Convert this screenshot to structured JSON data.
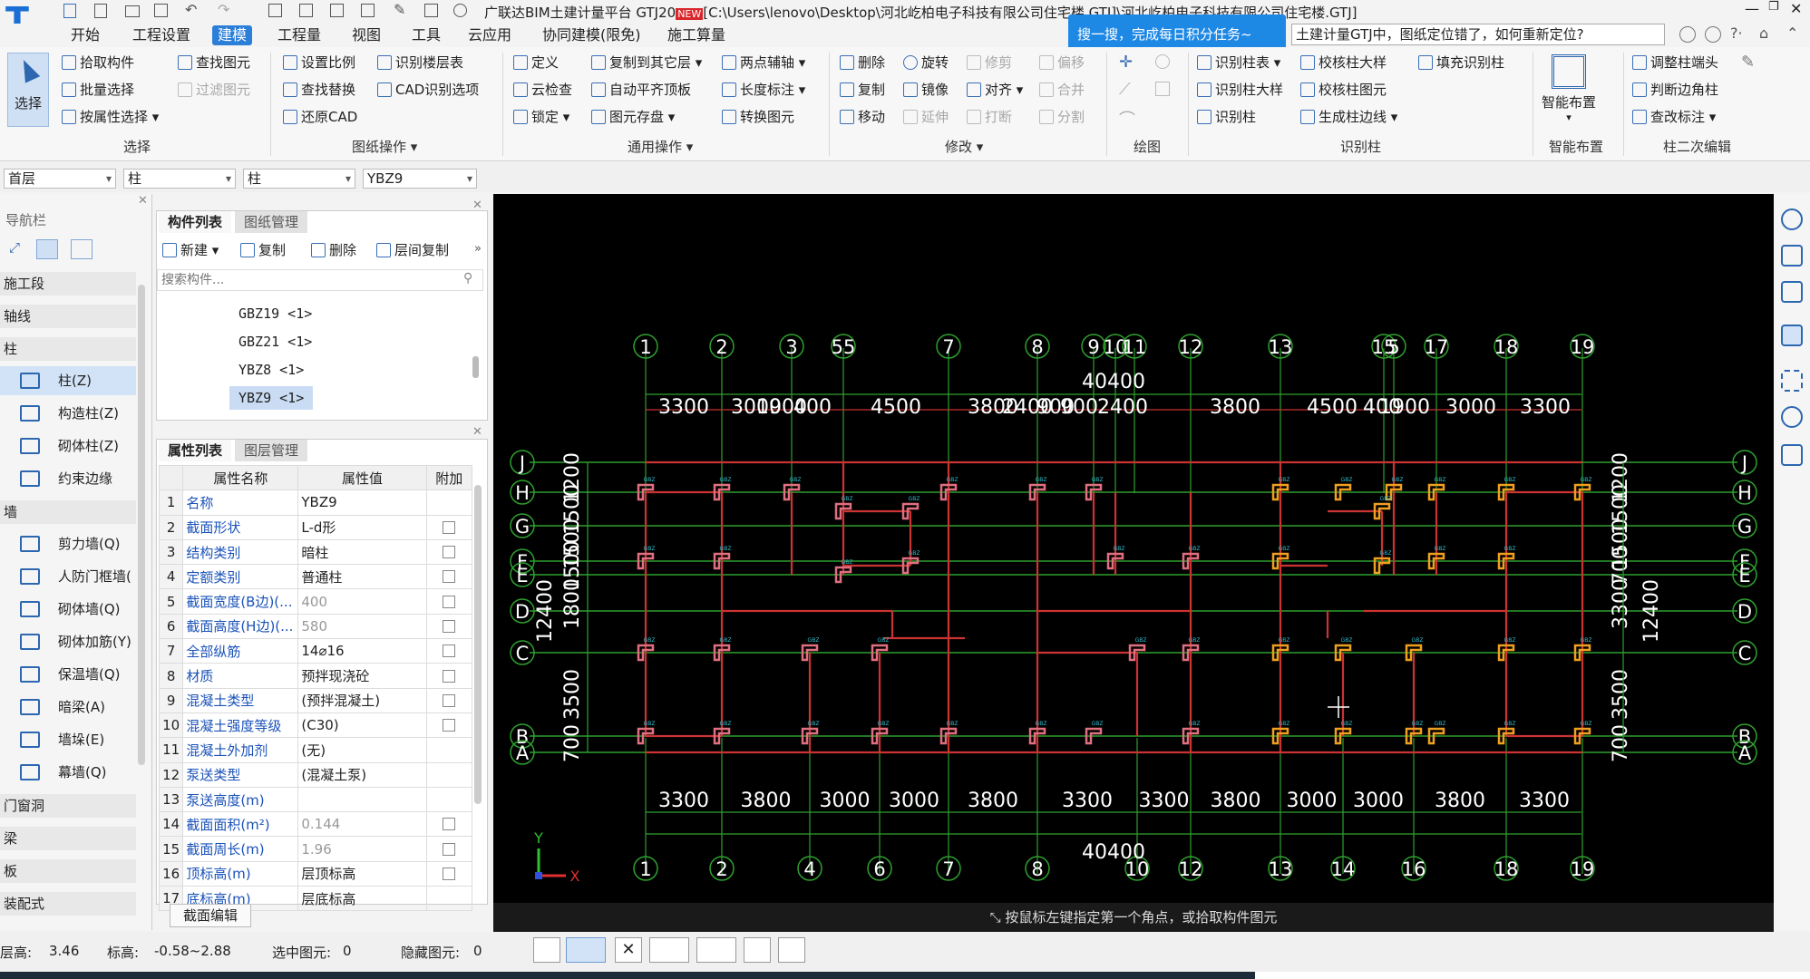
{
  "titlebar": {
    "title": "广联达BIM土建计量平台 GTJ20",
    "badge": "NEW",
    "path": "[C:\\Users\\lenovo\\Desktop\\河北屹柏电子科技有限公司住宅楼.GTJ]\\河北屹柏电子科技有限公司住宅楼.GTJ]",
    "popup": "搜一搜，完成每日积分任务~",
    "search_value": "土建计量GTJ中，图纸定位错了，如何重新定位?"
  },
  "menu": [
    "开始",
    "工程设置",
    "建模",
    "工程量",
    "视图",
    "工具",
    "云应用",
    "协同建模(限免)",
    "施工算量"
  ],
  "menu_active": "建模",
  "ribbon": {
    "select": "选择",
    "pick": "拾取构件",
    "batch": "批量选择",
    "byprop": "按属性选择",
    "findimg": "查找图元",
    "filterimg": "过滤图元",
    "grp_select": "选择",
    "setscale": "设置比例",
    "findreplace": "查找替换",
    "restorecad": "还原CAD",
    "idfloor": "识别楼层表",
    "cadopt": "CAD识别选项",
    "grp_drawing": "图纸操作",
    "define": "定义",
    "cloudcheck": "云检查",
    "lock": "锁定",
    "copyfloor": "复制到其它层",
    "autoalign": "自动平齐顶板",
    "saveimg": "图元存盘",
    "twopoint": "两点辅轴",
    "lengthmark": "长度标注",
    "convert": "转换图元",
    "grp_general": "通用操作",
    "delete": "删除",
    "copy": "复制",
    "move": "移动",
    "rotate": "旋转",
    "mirror": "镜像",
    "extend": "延伸",
    "trim": "修剪",
    "align": "对齐",
    "break": "打断",
    "offset": "偏移",
    "merge": "合并",
    "split": "分割",
    "grp_modify": "修改",
    "grp_draw": "绘图",
    "idcoltable": "识别柱表",
    "idcolbig": "识别柱大样",
    "idcol": "识别柱",
    "checkcolbig": "校核柱大样",
    "checkcol": "校核柱图元",
    "genedge": "生成柱边线",
    "fillcol": "填充识别柱",
    "grp_idcol": "识别柱",
    "smart": "智能布置",
    "grp_smart": "智能布置",
    "adjhead": "调整柱端头",
    "judgecorner": "判断边角柱",
    "changemark": "查改标注",
    "grp_second": "柱二次编辑"
  },
  "selectors": [
    "首层",
    "柱",
    "柱",
    "YBZ9"
  ],
  "nav": {
    "title": "导航栏",
    "items": [
      {
        "t": "h",
        "label": "施工段"
      },
      {
        "t": "h",
        "label": "轴线"
      },
      {
        "t": "h",
        "label": "柱"
      },
      {
        "t": "i",
        "label": "柱(Z)",
        "active": true
      },
      {
        "t": "i",
        "label": "构造柱(Z)"
      },
      {
        "t": "i",
        "label": "砌体柱(Z)"
      },
      {
        "t": "i",
        "label": "约束边缘非..."
      },
      {
        "t": "h",
        "label": "墙"
      },
      {
        "t": "i",
        "label": "剪力墙(Q)"
      },
      {
        "t": "i",
        "label": "人防门框墙("
      },
      {
        "t": "i",
        "label": "砌体墙(Q)"
      },
      {
        "t": "i",
        "label": "砌体加筋(Y)"
      },
      {
        "t": "i",
        "label": "保温墙(Q)"
      },
      {
        "t": "i",
        "label": "暗梁(A)"
      },
      {
        "t": "i",
        "label": "墙垛(E)"
      },
      {
        "t": "i",
        "label": "幕墙(Q)"
      },
      {
        "t": "h",
        "label": "门窗洞"
      },
      {
        "t": "h",
        "label": "梁"
      },
      {
        "t": "h",
        "label": "板"
      },
      {
        "t": "h",
        "label": "装配式"
      }
    ]
  },
  "complist": {
    "tabs": [
      "构件列表",
      "图纸管理"
    ],
    "new": "新建",
    "copy": "复制",
    "delete": "删除",
    "floorcopy": "层间复制",
    "search_placeholder": "搜索构件...",
    "items": [
      "GBZ19 <1>",
      "GBZ21 <1>",
      "YBZ8 <1>",
      "YBZ9 <1>"
    ],
    "selected": "YBZ9 <1>"
  },
  "props": {
    "tabs": [
      "属性列表",
      "图层管理"
    ],
    "headers": [
      "属性名称",
      "属性值",
      "附加"
    ],
    "rows": [
      {
        "n": "1",
        "k": "名称",
        "v": "YBZ9",
        "cb": false
      },
      {
        "n": "2",
        "k": "截面形状",
        "v": "L-d形",
        "cb": true
      },
      {
        "n": "3",
        "k": "结构类别",
        "v": "暗柱",
        "cb": true
      },
      {
        "n": "4",
        "k": "定额类别",
        "v": "普通柱",
        "cb": true
      },
      {
        "n": "5",
        "k": "截面宽度(B边)(...",
        "v": "400",
        "cb": true,
        "grey": true
      },
      {
        "n": "6",
        "k": "截面高度(H边)(...",
        "v": "580",
        "cb": true,
        "grey": true
      },
      {
        "n": "7",
        "k": "全部纵筋",
        "v": "14⌀16",
        "cb": true
      },
      {
        "n": "8",
        "k": "材质",
        "v": "预拌现浇砼",
        "cb": true
      },
      {
        "n": "9",
        "k": "混凝土类型",
        "v": "(预拌混凝土)",
        "cb": true
      },
      {
        "n": "10",
        "k": "混凝土强度等级",
        "v": "(C30)",
        "cb": true
      },
      {
        "n": "11",
        "k": "混凝土外加剂",
        "v": "(无)",
        "cb": false
      },
      {
        "n": "12",
        "k": "泵送类型",
        "v": "(混凝土泵)",
        "cb": false
      },
      {
        "n": "13",
        "k": "泵送高度(m)",
        "v": "",
        "cb": false
      },
      {
        "n": "14",
        "k": "截面面积(m²)",
        "v": "0.144",
        "cb": true,
        "grey": true
      },
      {
        "n": "15",
        "k": "截面周长(m)",
        "v": "1.96",
        "cb": true,
        "grey": true
      },
      {
        "n": "16",
        "k": "顶标高(m)",
        "v": "层顶标高",
        "cb": true
      },
      {
        "n": "17",
        "k": "底标高(m)",
        "v": "层底标高",
        "cb": false
      }
    ],
    "edit_btn": "截面编辑"
  },
  "cad": {
    "top_axes": [
      "1",
      "2",
      "3",
      "55",
      "7",
      "8",
      "9",
      "10",
      "11",
      "12",
      "13",
      "15",
      "5",
      "17",
      "18",
      "19"
    ],
    "top_total": "40400",
    "top_dims": [
      "3300",
      "3000",
      "1900",
      "400",
      "4500",
      "3800",
      "2400",
      "900",
      "900",
      "2400",
      "3800",
      "4500",
      "400",
      "1900",
      "3000",
      "3300"
    ],
    "bottom_axes": [
      "1",
      "2",
      "4",
      "6",
      "7",
      "8",
      "10",
      "12",
      "13",
      "14",
      "16",
      "18",
      "19"
    ],
    "bottom_total": "40400",
    "bottom_dims": [
      "3300",
      "3800",
      "3000",
      "3000",
      "3800",
      "3300",
      "3300",
      "3800",
      "3000",
      "3000",
      "3800",
      "3300"
    ],
    "rows": [
      "J",
      "H",
      "G",
      "F",
      "E",
      "D",
      "C",
      "B",
      "A"
    ],
    "left_dims": [
      "1200",
      "1500",
      "1500",
      "1500",
      "1800",
      "3500",
      "700"
    ],
    "left_total": "12400",
    "right_dims": [
      "1200",
      "1500",
      "1500",
      "700",
      "3300",
      "3500",
      "700"
    ],
    "right_total": "12400",
    "ucs_x": "X",
    "ucs_y": "Y",
    "status": "按鼠标左键指定第一个角点，或拾取构件图元"
  },
  "status": {
    "floor_h": "层高:",
    "floor_hv": "3.46",
    "elev": "标高:",
    "elevv": "-0.58~2.88",
    "sel": "选中图元:",
    "selv": "0",
    "hid": "隐藏图元:",
    "hidv": "0"
  },
  "colors": {
    "accent": "#2b7fd9",
    "grid": "#2ea02e",
    "wall": "#cc3333",
    "column": "#f0a020",
    "cad_bg": "#000000"
  }
}
